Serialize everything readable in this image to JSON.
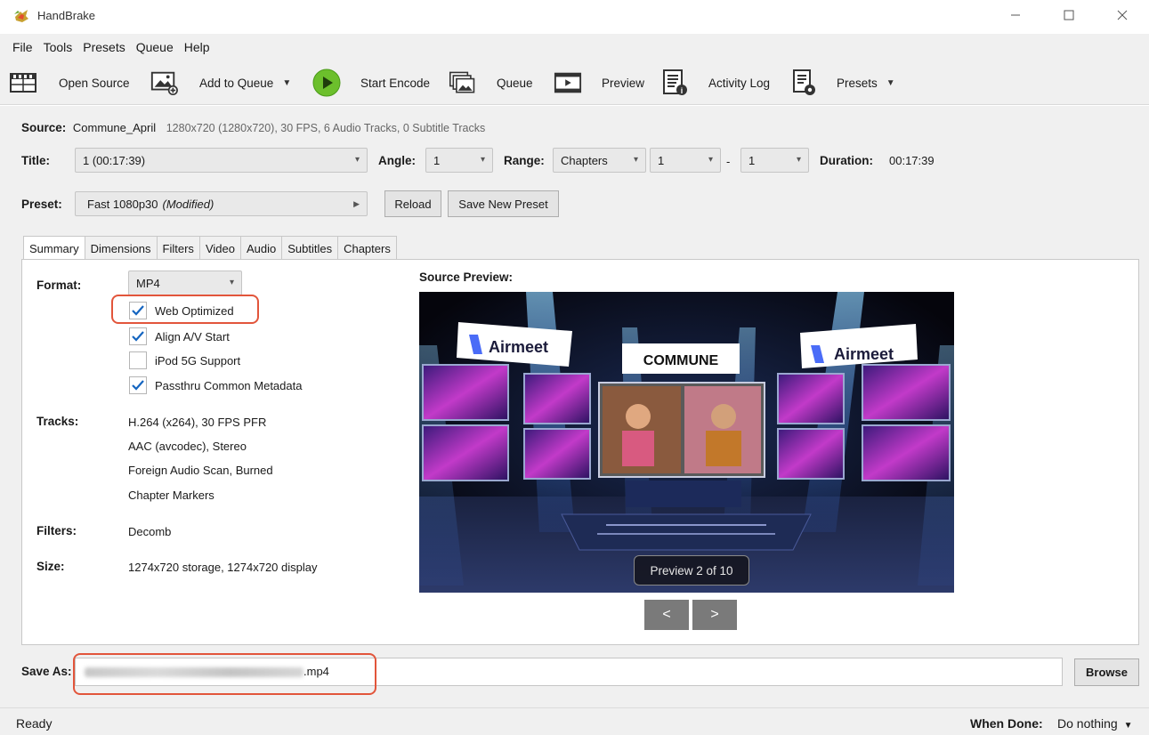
{
  "window": {
    "title": "HandBrake",
    "controls": [
      "minimize-icon",
      "maximize-icon",
      "close-icon"
    ]
  },
  "menu": [
    "File",
    "Tools",
    "Presets",
    "Queue",
    "Help"
  ],
  "toolbar": {
    "open_source": "Open Source",
    "add_to_queue": "Add to Queue",
    "start_encode": "Start Encode",
    "queue": "Queue",
    "preview": "Preview",
    "activity_log": "Activity Log",
    "presets": "Presets"
  },
  "source": {
    "label": "Source:",
    "name": "Commune_April",
    "info": "1280x720 (1280x720), 30 FPS, 6 Audio Tracks, 0 Subtitle Tracks"
  },
  "title_row": {
    "title_label": "Title:",
    "title_value": "1 (00:17:39)",
    "angle_label": "Angle:",
    "angle_value": "1",
    "range_label": "Range:",
    "range_type": "Chapters",
    "range_start": "1",
    "range_sep": "-",
    "range_end": "1",
    "duration_label": "Duration:",
    "duration_value": "00:17:39"
  },
  "preset_row": {
    "label": "Preset:",
    "name": "Fast 1080p30",
    "modified": "(Modified)",
    "reload": "Reload",
    "save_new": "Save New Preset"
  },
  "tabs": [
    "Summary",
    "Dimensions",
    "Filters",
    "Video",
    "Audio",
    "Subtitles",
    "Chapters"
  ],
  "active_tab": "Summary",
  "summary": {
    "format_label": "Format:",
    "format_value": "MP4",
    "options": [
      {
        "label": "Web Optimized",
        "checked": true
      },
      {
        "label": "Align A/V Start",
        "checked": true
      },
      {
        "label": "iPod 5G Support",
        "checked": false
      },
      {
        "label": "Passthru Common Metadata",
        "checked": true
      }
    ],
    "tracks_label": "Tracks:",
    "tracks": [
      "H.264 (x264), 30 FPS PFR",
      "AAC (avcodec), Stereo",
      "Foreign Audio Scan, Burned",
      "Chapter Markers"
    ],
    "filters_label": "Filters:",
    "filters_value": "Decomb",
    "size_label": "Size:",
    "size_value": "1274x720 storage, 1274x720 display",
    "preview_label": "Source Preview:",
    "preview_counter": "Preview 2 of 10",
    "prev_button": "<",
    "next_button": ">",
    "scene": {
      "brand_left": "Airmeet",
      "brand_center": "COMMUNE",
      "brand_right": "Airmeet"
    }
  },
  "save_as": {
    "label": "Save As:",
    "path_visible_suffix": ".mp4",
    "browse": "Browse"
  },
  "status": {
    "text": "Ready",
    "when_done_label": "When Done:",
    "when_done_value": "Do nothing"
  },
  "colors": {
    "highlight": "#e2553b",
    "checkbox_accent": "#1565c0",
    "start_encode_green": "#6cbf2c"
  }
}
